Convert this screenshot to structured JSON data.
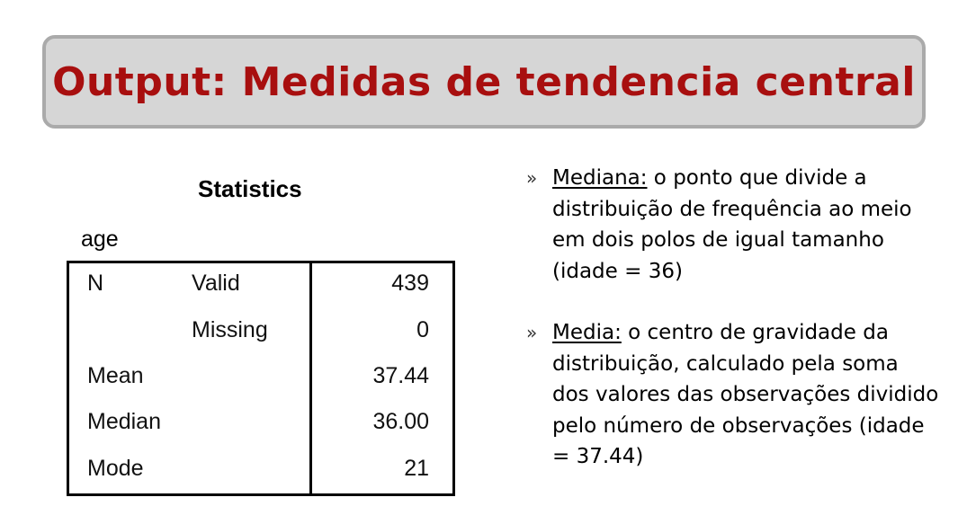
{
  "title": "Output: Medidas de tendencia central",
  "statistics": {
    "heading": "Statistics",
    "variable": "age",
    "rows": [
      {
        "label": "N",
        "sublabel": "Valid",
        "value": "439"
      },
      {
        "label": "",
        "sublabel": "Missing",
        "value": "0"
      },
      {
        "label": "Mean",
        "sublabel": "",
        "value": "37.44"
      },
      {
        "label": "Median",
        "sublabel": "",
        "value": "36.00"
      },
      {
        "label": "Mode",
        "sublabel": "",
        "value": "21"
      }
    ]
  },
  "bullets": [
    {
      "marker": "»",
      "term": "Mediana:",
      "text": " o ponto que divide a distribuição de frequência ao meio em dois polos de igual tamanho (idade = 36)"
    },
    {
      "marker": "»",
      "term": "Media:",
      "text": " o centro de gravidade da distribuição, calculado pela soma dos valores das observações dividido pelo número de observações (idade = 37.44)"
    }
  ]
}
